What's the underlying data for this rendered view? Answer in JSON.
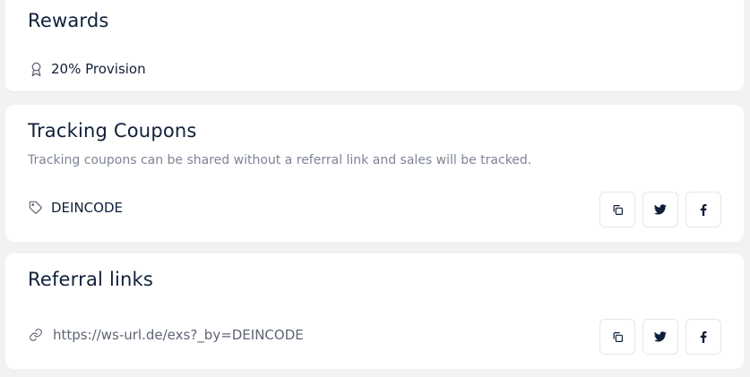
{
  "rewards": {
    "title": "Rewards",
    "provision_text": "20% Provision",
    "icon": "award-icon"
  },
  "coupons": {
    "title": "Tracking Coupons",
    "description": "Tracking coupons can be shared without a referral link and sales will be tracked.",
    "code": "DEINCODE",
    "icon": "tag-icon",
    "actions": [
      "copy-icon",
      "twitter-icon",
      "facebook-icon"
    ]
  },
  "links": {
    "title": "Referral links",
    "url": "https://ws-url.de/exs?_by=DEINCODE",
    "icon": "link-icon",
    "actions": [
      "copy-icon",
      "twitter-icon",
      "facebook-icon"
    ]
  },
  "colors": {
    "background": "#f1f2f4",
    "card": "#ffffff",
    "text": "#0f1f3a",
    "muted": "#7d8593"
  }
}
